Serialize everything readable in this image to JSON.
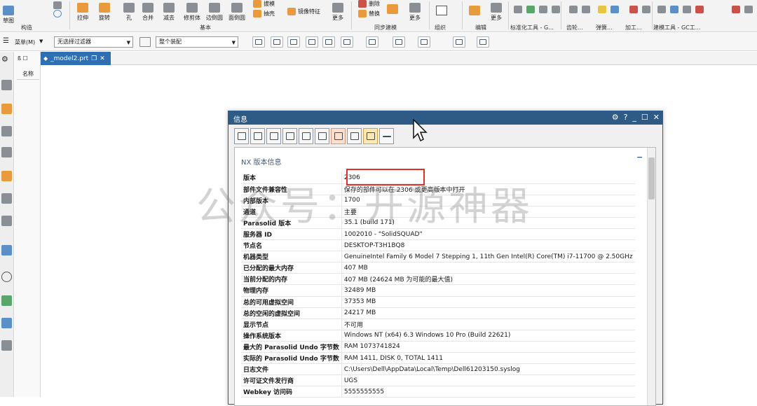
{
  "ribbon": {
    "sketch_label": "草图",
    "buttons": [
      "拉伸",
      "旋转",
      "孔",
      "合并",
      "减去",
      "修剪体",
      "边倒圆",
      "面倒圆"
    ],
    "small_buttons": [
      "拔模",
      "抽壳"
    ],
    "mirror_label": "镜像特征",
    "more_label": "更多",
    "sync_small": [
      "删除",
      "替换"
    ],
    "groups": {
      "construct": "构造",
      "basic": "基本",
      "sync": "同步建模",
      "organize": "组织",
      "edit": "编辑",
      "std_tools": "标准化工具 - G...",
      "gear": "齿轮...",
      "spring": "弹簧...",
      "machining": "加工...",
      "modeling_tools": "建模工具 - GC工..."
    }
  },
  "toolbar2": {
    "menu_label": "菜单(M)",
    "filter_value": "无选择过滤器",
    "assembly_value": "整个装配"
  },
  "tab": {
    "label": "_model2.prt"
  },
  "nav": {
    "header": "名称"
  },
  "dialog": {
    "title": "信息",
    "section_title": "NX 版本信息",
    "rows": [
      {
        "key": "版本",
        "value": "2306"
      },
      {
        "key": "部件文件兼容性",
        "value": "保存的部件可以在 2306 或更高版本中打开"
      },
      {
        "key": "内部版本",
        "value": "1700"
      },
      {
        "key": "通道",
        "value": "主要"
      },
      {
        "key": "Parasolid 版本",
        "value": "35.1 (build 171)"
      },
      {
        "key": "服务器 ID",
        "value": "1002010 - \"SolidSQUAD\""
      },
      {
        "key": "节点名",
        "value": "DESKTOP-T3H1BQ8"
      },
      {
        "key": "机器类型",
        "value": "GenuineIntel Family 6 Model 7 Stepping 1, 11th Gen Intel(R) Core(TM) i7-11700 @ 2.50GHz"
      },
      {
        "key": "已分配的最大内存",
        "value": "407 MB"
      },
      {
        "key": "当前分配的内存",
        "value": "407 MB (24624 MB 为可能的最大值)"
      },
      {
        "key": "物理内存",
        "value": "32489 MB"
      },
      {
        "key": "总的可用虚拟空间",
        "value": "37353 MB"
      },
      {
        "key": "总的空闲的虚拟空间",
        "value": "24217 MB"
      },
      {
        "key": "显示节点",
        "value": "不可用"
      },
      {
        "key": "操作系统版本",
        "value": "Windows NT (x64) 6.3 Windows 10 Pro (Build 22621)"
      },
      {
        "key": "最大的 Parasolid Undo 字节数",
        "value": "RAM 1073741824"
      },
      {
        "key": "实际的 Parasolid Undo 字节数",
        "value": "RAM 1411, DISK 0, TOTAL 1411"
      },
      {
        "key": "日志文件",
        "value": "C:\\Users\\Dell\\AppData\\Local\\Temp\\Dell61203150.syslog"
      },
      {
        "key": "许可证文件发行商",
        "value": "UGS"
      },
      {
        "key": "Webkey 访问码",
        "value": "5555555555"
      }
    ]
  },
  "watermark": "公众号：开源神器",
  "colors": {
    "title_bar": "#2e5b85",
    "tab_active": "#2e6fb3",
    "highlight": "#e0302a"
  }
}
